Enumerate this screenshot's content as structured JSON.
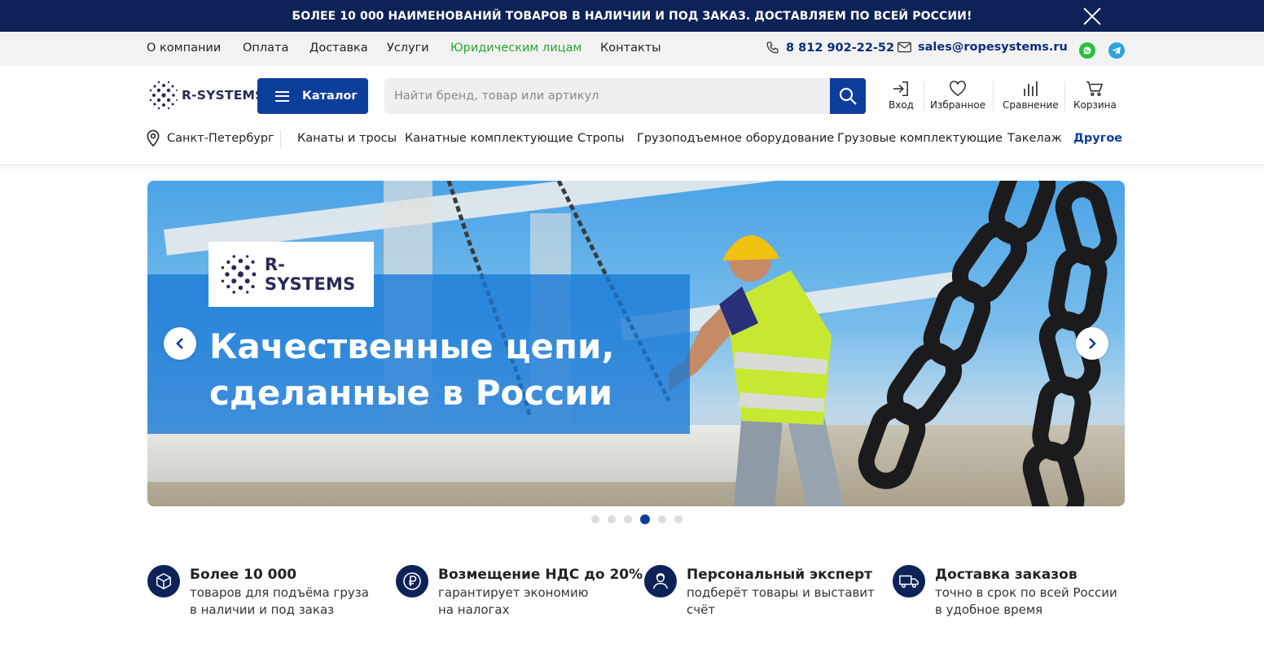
{
  "promo": {
    "text": "БОЛЕЕ 10 000 НАИМЕНОВАНИЙ ТОВАРОВ В НАЛИЧИИ И ПОД ЗАКАЗ. ДОСТАВЛЯЕМ ПО ВСЕЙ РОССИИ!",
    "close_icon": "close-icon"
  },
  "infobar": {
    "links": [
      "О компании",
      "Оплата",
      "Доставка",
      "Услуги",
      "Юридическим лицам",
      "Контакты"
    ],
    "phone": "8 812 902-22-52",
    "email": "sales@ropesystems.ru",
    "social": [
      "whatsapp-icon",
      "telegram-icon"
    ]
  },
  "header": {
    "logo_text": "R-SYSTEMS",
    "catalog_label": "Каталог",
    "search_placeholder": "Найти бренд, товар или артикул",
    "actions": {
      "login": "Вход",
      "favorites": "Избранное",
      "compare": "Сравнение",
      "cart": "Корзина"
    },
    "city": "Санкт-Петербург",
    "categories": [
      "Канаты и тросы",
      "Канатные комплектующие",
      "Стропы",
      "Грузоподъемное оборудование",
      "Грузовые комплектующие",
      "Такелаж",
      "Другое"
    ]
  },
  "banner": {
    "logo_text": "R-SYSTEMS",
    "title_line1": "Качественные цепи,",
    "title_line2": "сделанные в России",
    "slides_count": 6,
    "active_slide": 4
  },
  "features": [
    {
      "icon": "box-icon",
      "title": "Более 10 000",
      "line1": "товаров для подъёма груза",
      "line2": "в наличии и под заказ"
    },
    {
      "icon": "ruble-icon",
      "title": "Возмещение НДС до 20%",
      "line1": "гарантирует экономию",
      "line2": "на налогах"
    },
    {
      "icon": "expert-icon",
      "title": "Персональный эксперт",
      "line1": "подберёт товары и выставит",
      "line2": "счёт"
    },
    {
      "icon": "truck-icon",
      "title": "Доставка заказов",
      "line1": "точно в срок по всей России",
      "line2": "в удобное время"
    }
  ],
  "colors": {
    "navy": "#0d2257",
    "brand_blue": "#0d3e9c",
    "green_link": "#2aa52f",
    "infobar_bg": "#f2f2f2"
  }
}
